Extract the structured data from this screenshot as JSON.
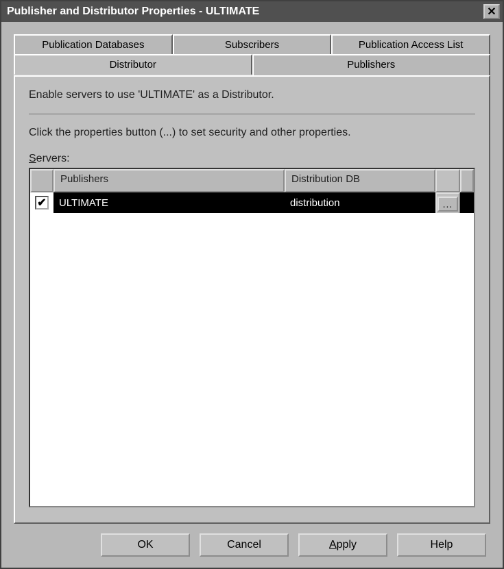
{
  "titlebar": {
    "text": "Publisher and Distributor Properties - ULTIMATE"
  },
  "tabs": {
    "back": [
      {
        "label": "Publication Databases"
      },
      {
        "label": "Subscribers"
      },
      {
        "label": "Publication Access List"
      }
    ],
    "front": [
      {
        "label": "Distributor"
      },
      {
        "label": "Publishers"
      }
    ]
  },
  "panel": {
    "desc1": "Enable servers to use 'ULTIMATE' as a Distributor.",
    "desc2": "Click the properties button (...) to set security and other properties.",
    "servers_label_pre": "S",
    "servers_label_post": "ervers:",
    "columns": {
      "publishers": "Publishers",
      "distdb": "Distribution DB"
    },
    "rows": [
      {
        "checked": "✔",
        "publisher": "ULTIMATE",
        "distdb": "distribution",
        "props": "..."
      }
    ]
  },
  "buttons": {
    "ok": "OK",
    "cancel": "Cancel",
    "apply_pre": "A",
    "apply_post": "pply",
    "help": "Help"
  }
}
